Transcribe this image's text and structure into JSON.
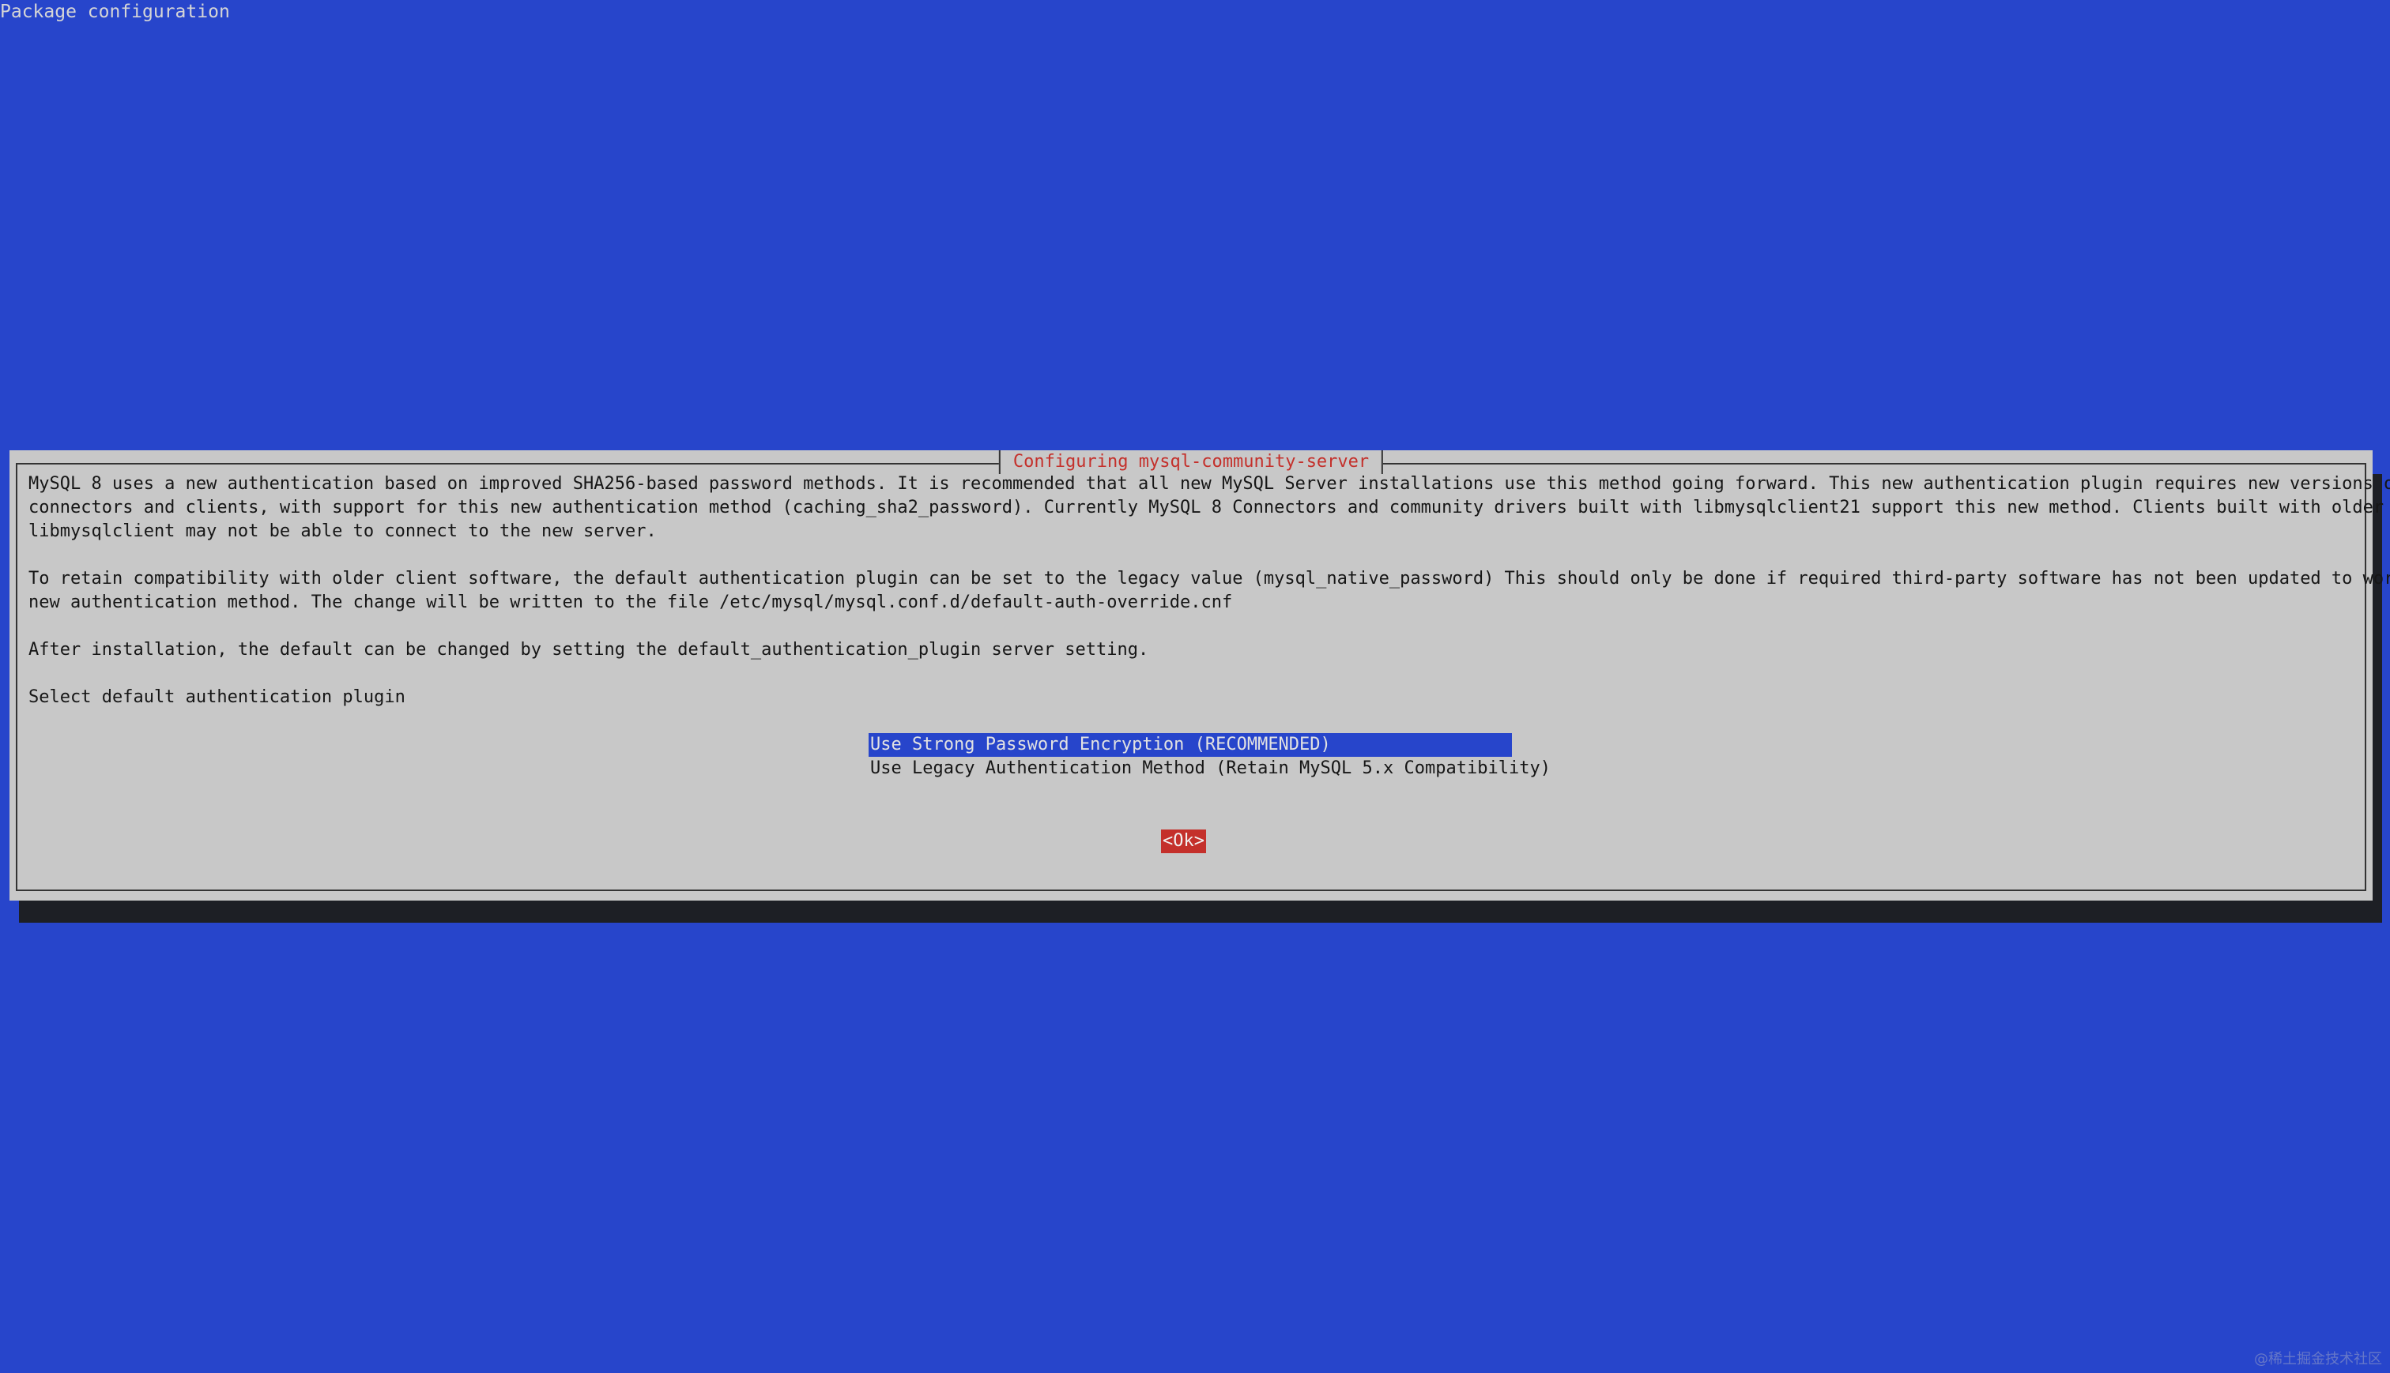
{
  "window": {
    "title": "Package configuration"
  },
  "dialog": {
    "title": "Configuring mysql-community-server",
    "paragraph_lines": [
      "MySQL 8 uses a new authentication based on improved SHA256-based password methods. It is recommended that all new MySQL Server installations use this method going forward. This new authentication plugin requires new versions of",
      "connectors and clients, with support for this new authentication method (caching_sha2_password). Currently MySQL 8 Connectors and community drivers built with libmysqlclient21 support this new method. Clients built with older versions of",
      "libmysqlclient may not be able to connect to the new server.",
      "",
      "To retain compatibility with older client software, the default authentication plugin can be set to the legacy value (mysql_native_password) This should only be done if required third-party software has not been updated to work with the",
      "new authentication method. The change will be written to the file /etc/mysql/mysql.conf.d/default-auth-override.cnf",
      "",
      "After installation, the default can be changed by setting the default_authentication_plugin server setting.",
      "",
      "Select default authentication plugin"
    ],
    "options": [
      "Use Strong Password Encryption (RECOMMENDED)",
      "Use Legacy Authentication Method (Retain MySQL 5.x Compatibility)"
    ],
    "selected_option_index": 0,
    "ok_label": "<Ok>"
  },
  "watermark": "@稀土掘金技术社区",
  "colors": {
    "background": "#2745cb",
    "dialog": "#c8c8c8",
    "title_red": "#c4302b",
    "selection": "#2745cb",
    "button": "#c4302b",
    "shadow": "#1d1f25"
  }
}
